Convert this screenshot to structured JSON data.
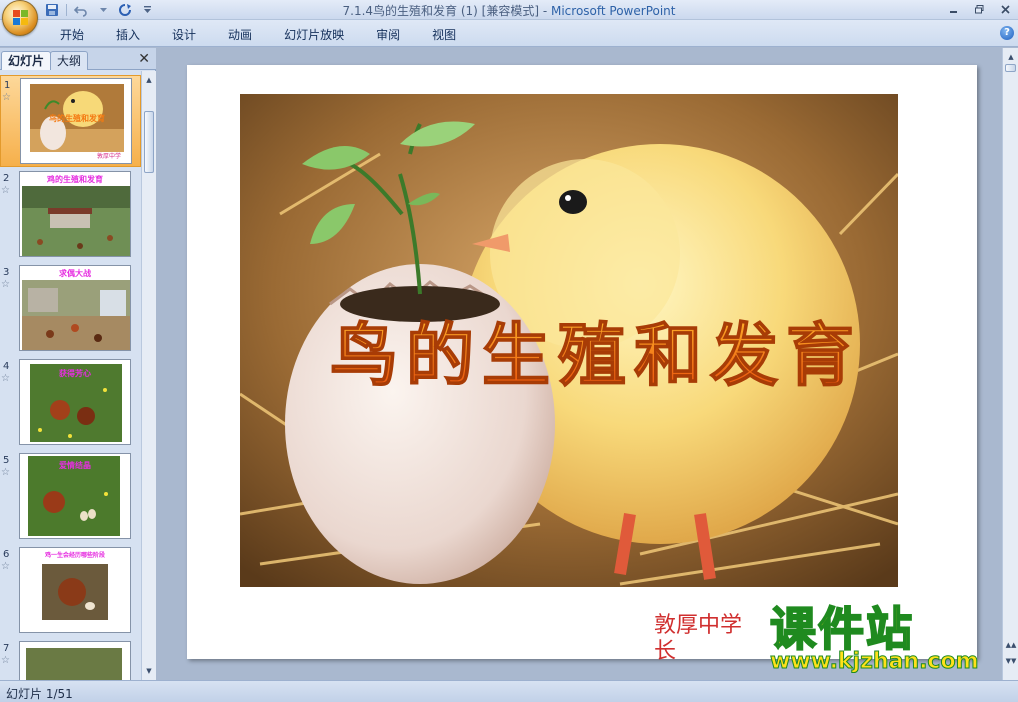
{
  "window": {
    "title_doc": "7.1.4鸟的生殖和发育 (1) [兼容模式] - ",
    "title_app": "Microsoft PowerPoint"
  },
  "quick_access": {
    "icons": [
      "save-icon",
      "undo-icon",
      "redo-icon",
      "customize-icon"
    ]
  },
  "ribbon": {
    "tabs": [
      "开始",
      "插入",
      "设计",
      "动画",
      "幻灯片放映",
      "审阅",
      "视图"
    ]
  },
  "left_pane": {
    "tab_slides": "幻灯片",
    "tab_outline": "大纲",
    "close_glyph": "✕",
    "thumbnails": [
      {
        "number": "1",
        "caption": "",
        "sub": "敦厚中学",
        "selected": true
      },
      {
        "number": "2",
        "caption": "鸡的生殖和发育",
        "sub": "",
        "selected": false
      },
      {
        "number": "3",
        "caption": "求偶大战",
        "sub": "",
        "selected": false
      },
      {
        "number": "4",
        "caption": "获得芳心",
        "sub": "",
        "selected": false
      },
      {
        "number": "5",
        "caption": "爱情结晶",
        "sub": "",
        "selected": false
      },
      {
        "number": "6",
        "caption": "鸡一生会经历哪些阶段",
        "sub": "",
        "selected": false
      },
      {
        "number": "7",
        "caption": "",
        "sub": "",
        "selected": false
      }
    ]
  },
  "slide": {
    "title": "鸟的生殖和发育",
    "subtitle": "敦厚中学 长"
  },
  "watermark": {
    "main": "课件站",
    "url": "www.kjzhan.com"
  },
  "status": {
    "slide_counter": "幻灯片 1/51"
  },
  "colors": {
    "title_orange": "#f47a12",
    "subtitle_red": "#d02f2f",
    "selected_thumb": "#f6b04b",
    "workspace": "#a9b8cf"
  }
}
